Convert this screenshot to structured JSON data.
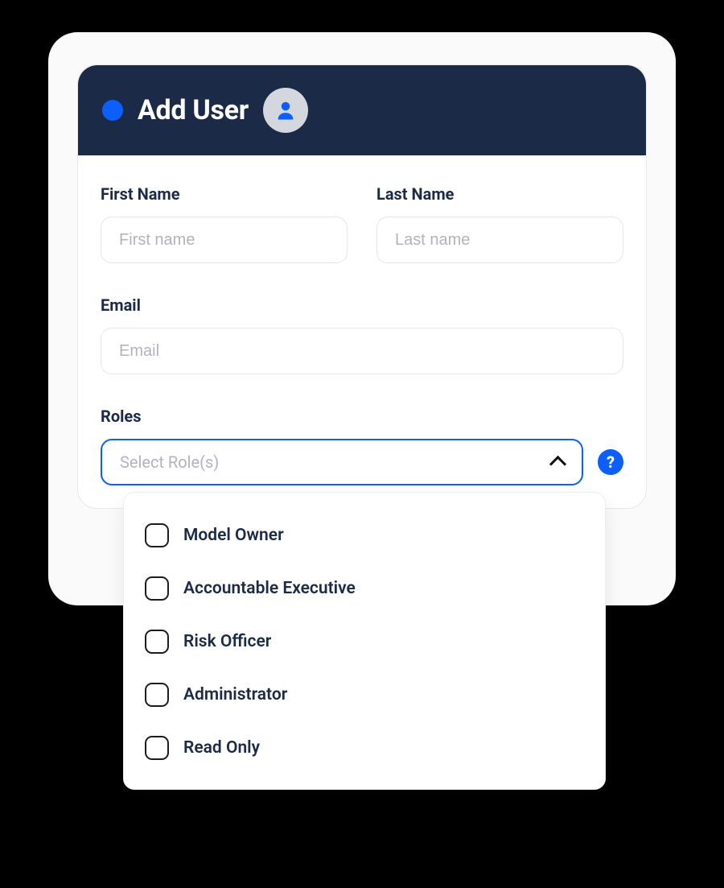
{
  "colors": {
    "header_bg": "#1b2a47",
    "accent_blue": "#0b5fff",
    "avatar_bg": "#d4d7de",
    "text_primary": "#1b2a47",
    "placeholder": "#b1b3bd"
  },
  "header": {
    "title": "Add User",
    "dot_icon": "status-dot-icon",
    "avatar_icon": "user-silhouette-icon"
  },
  "fields": {
    "first_name": {
      "label": "First Name",
      "placeholder": "First name",
      "value": ""
    },
    "last_name": {
      "label": "Last Name",
      "placeholder": "Last name",
      "value": ""
    },
    "email": {
      "label": "Email",
      "placeholder": "Email",
      "value": ""
    },
    "roles": {
      "label": "Roles",
      "placeholder": "Select Role(s)",
      "expanded": true,
      "help_icon": "?",
      "options": [
        {
          "label": "Model Owner",
          "checked": false
        },
        {
          "label": "Accountable Executive",
          "checked": false
        },
        {
          "label": "Risk Officer",
          "checked": false
        },
        {
          "label": "Administrator",
          "checked": false
        },
        {
          "label": "Read Only",
          "checked": false
        }
      ]
    }
  }
}
